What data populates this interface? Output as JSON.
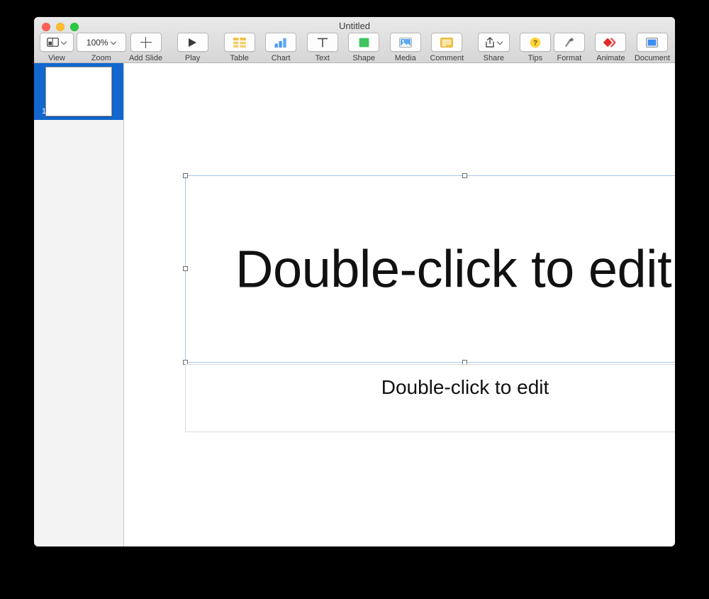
{
  "window": {
    "title": "Untitled",
    "traffic_lights": [
      {
        "name": "close",
        "color": "#ff6159"
      },
      {
        "name": "minimize",
        "color": "#ffbd2e"
      },
      {
        "name": "zoom",
        "color": "#2ac940"
      }
    ]
  },
  "toolbar": {
    "left_group": [
      {
        "id": "view",
        "label": "View",
        "icon": "sidebar-layout-icon",
        "has_chevron": true
      },
      {
        "id": "zoom",
        "label": "Zoom",
        "value": "100%",
        "icon": "zoom-value",
        "has_chevron": true
      },
      {
        "id": "add_slide",
        "label": "Add Slide",
        "icon": "plus-icon",
        "has_chevron": false
      },
      {
        "id": "play",
        "label": "Play",
        "icon": "play-triangle-icon",
        "has_chevron": false
      }
    ],
    "insert_group": [
      {
        "id": "table",
        "label": "Table",
        "icon": "table-grid-icon",
        "color": "#f5c242"
      },
      {
        "id": "chart",
        "label": "Chart",
        "icon": "bar-chart-icon",
        "color": "#3d8ef5"
      },
      {
        "id": "text",
        "label": "Text",
        "icon": "text-t-icon",
        "color": "#4a4a4a"
      },
      {
        "id": "shape",
        "label": "Shape",
        "icon": "green-square-icon",
        "color": "#3ec45d"
      },
      {
        "id": "media",
        "label": "Media",
        "icon": "photo-image-icon",
        "color": "#4a9bf0"
      },
      {
        "id": "comment",
        "label": "Comment",
        "icon": "comment-note-icon",
        "color": "#f5c242"
      }
    ],
    "share_group": [
      {
        "id": "share",
        "label": "Share",
        "icon": "share-arrow-up-icon",
        "has_chevron": true
      },
      {
        "id": "tips",
        "label": "Tips",
        "icon": "question-mark-icon",
        "color": "#ffd43b"
      }
    ],
    "inspector_group": [
      {
        "id": "format",
        "label": "Format",
        "icon": "paintbrush-icon",
        "color": "#555555"
      },
      {
        "id": "animate",
        "label": "Animate",
        "icon": "red-diamond-chevron-icon",
        "color": "#e03131"
      },
      {
        "id": "document",
        "label": "Document",
        "icon": "document-rect-icon",
        "color": "#3d8ef5"
      }
    ]
  },
  "sidebar": {
    "slides": [
      {
        "number": "1",
        "selected": true
      }
    ]
  },
  "canvas": {
    "title_placeholder": {
      "text": "Double-click to edit",
      "selected": true
    },
    "body_placeholder": {
      "text": "Double-click to edit",
      "selected": false
    }
  },
  "colors": {
    "selection_blue": "#a8c6ef",
    "slide_selected": "#1268ce",
    "toolbar_top": "#e9e9e9",
    "toolbar_bottom": "#d6d6d6"
  }
}
